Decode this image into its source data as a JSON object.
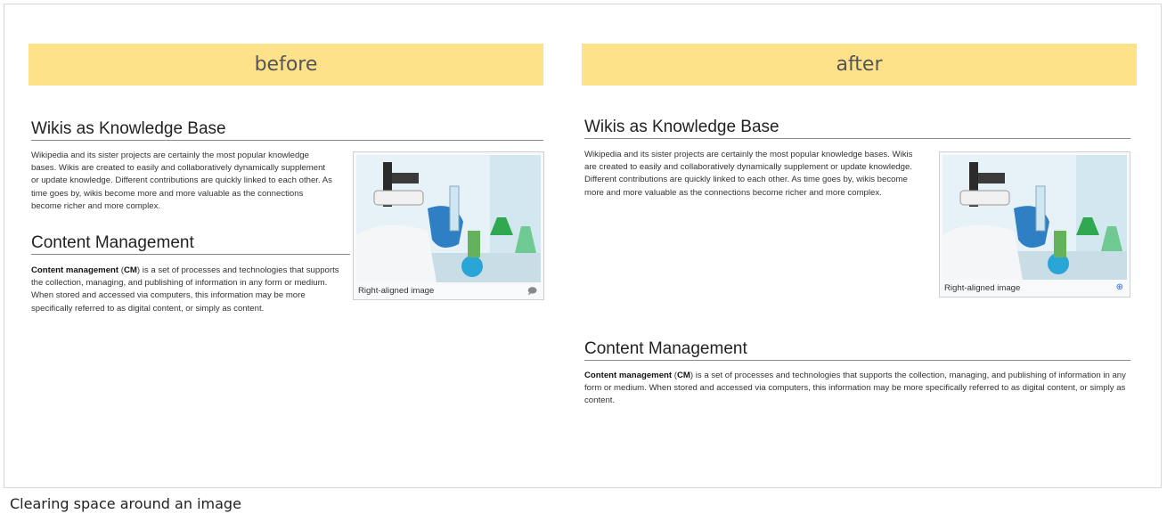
{
  "before": {
    "banner": "before",
    "section1": {
      "heading": "Wikis as Knowledge Base",
      "text": "Wikipedia and its sister projects are certainly the most popular knowledge bases. Wikis are created to easily and collaboratively dynamically supplement or update knowledge. Different contributions are quickly linked to each other. As time goes by, wikis become more and more valuable as the connections become richer and more complex."
    },
    "section2": {
      "heading": "Content Management",
      "bold": "Content management",
      "abbr_open": " (",
      "abbr": "CM",
      "text": ") is a set of processes and technologies that supports the collection, managing, and publishing of information in any form or medium.  When stored and accessed via computers, this information may be more specifically referred to as digital content, or simply as content."
    },
    "image_caption": "Right-aligned image"
  },
  "after": {
    "banner": "after",
    "section1": {
      "heading": "Wikis as Knowledge Base",
      "text": "Wikipedia and its sister projects are certainly the most popular knowledge bases. Wikis are created to easily and collaboratively dynamically supplement or update knowledge. Different contributions are quickly linked to each other. As time goes by, wikis become more and more valuable as the connections become richer and more complex."
    },
    "section2": {
      "heading": "Content Management",
      "bold": "Content management",
      "abbr_open": " (",
      "abbr": "CM",
      "text": ") is a set of processes and technologies that supports the collection, managing, and publishing of information in any form or medium. When stored and accessed via computers, this information may be more specifically referred to as digital content, or simply as content."
    },
    "image_caption": "Right-aligned image"
  },
  "figure_caption": "Clearing space around an image",
  "icons": {
    "before_caption_icon": "speech-bubble-icon",
    "after_caption_icon": "magnify-icon"
  },
  "colors": {
    "banner": "#fde28a",
    "link": "#3366cc"
  }
}
